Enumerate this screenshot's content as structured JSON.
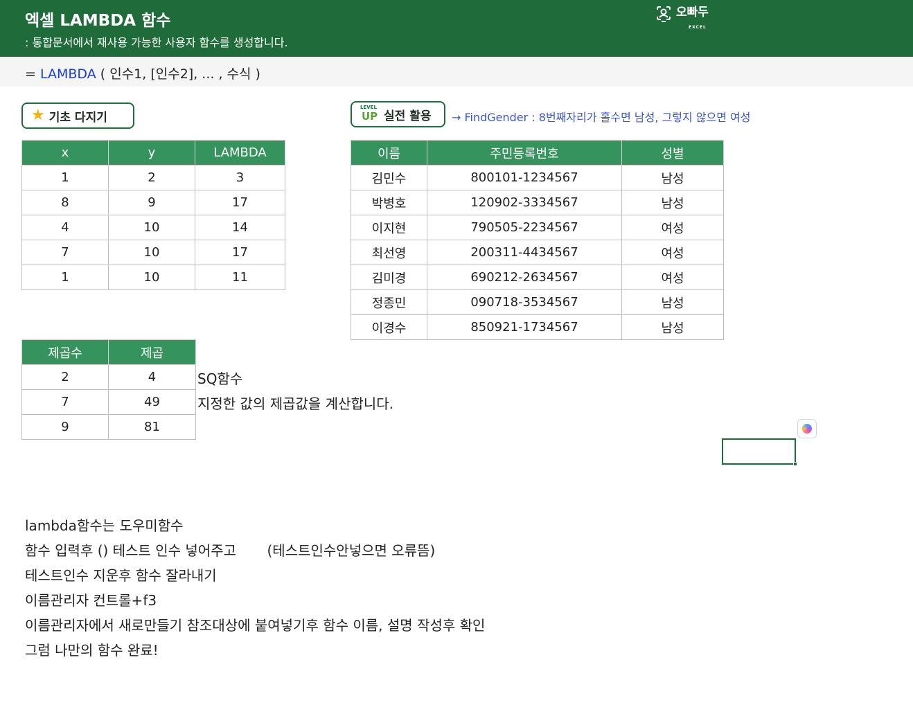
{
  "header": {
    "title": "엑셀 LAMBDA 함수",
    "subtitle": ": 통합문서에서 재사용 가능한 사용자 함수를 생성합니다.",
    "logo_text": "오빠두",
    "logo_sub": "EXCEL",
    "logo_icon": "camera-person-icon",
    "background_color": "#1f6b3a"
  },
  "formula": {
    "eq": "= ",
    "fn": "LAMBDA",
    "args": " ( 인수1, [인수2], ... , 수식 )",
    "fn_color": "#1a3fd0"
  },
  "badges": {
    "basic_label": "기초 다지기",
    "basic_icon": "star-icon",
    "level_top": "LEVEL",
    "level_up": "UP",
    "level_label": "실전 활용"
  },
  "practical_note": "→ FindGender : 8번째자리가 홀수면 남성, 그렇지 않으면 여성",
  "lambda_table": {
    "headers": [
      "x",
      "y",
      "LAMBDA"
    ],
    "rows": [
      [
        "1",
        "2",
        "3"
      ],
      [
        "8",
        "9",
        "17"
      ],
      [
        "4",
        "10",
        "14"
      ],
      [
        "7",
        "10",
        "17"
      ],
      [
        "1",
        "10",
        "11"
      ]
    ]
  },
  "gender_table": {
    "headers": [
      "이름",
      "주민등록번호",
      "성별"
    ],
    "rows": [
      [
        "김민수",
        "800101-1234567",
        "남성"
      ],
      [
        "박병호",
        "120902-3334567",
        "남성"
      ],
      [
        "이지현",
        "790505-2234567",
        "여성"
      ],
      [
        "최선영",
        "200311-4434567",
        "여성"
      ],
      [
        "김미경",
        "690212-2634567",
        "여성"
      ],
      [
        "정종민",
        "090718-3534567",
        "남성"
      ],
      [
        "이경수",
        "850921-1734567",
        "남성"
      ]
    ]
  },
  "square_table": {
    "headers": [
      "제곱수",
      "제곱"
    ],
    "rows": [
      [
        "2",
        "4"
      ],
      [
        "7",
        "49"
      ],
      [
        "9",
        "81"
      ]
    ]
  },
  "sq_note": {
    "title": "SQ함수",
    "desc": "지정한 값의 제곱값을 계산합니다."
  },
  "notes": [
    "lambda함수는 도우미함수",
    "함수 입력후 () 테스트 인수 넣어주고       (테스트인수안넣으면 오류뜸)",
    "테스트인수 지운후 함수 잘라내기",
    "이름관리자 컨트롤+f3",
    "이름관리자에서 새로만들기 참조대상에 붙여넣기후 함수 이름, 설명 작성후 확인",
    "그럼 나만의 함수 완료!"
  ],
  "table_header_color": "#35935e"
}
